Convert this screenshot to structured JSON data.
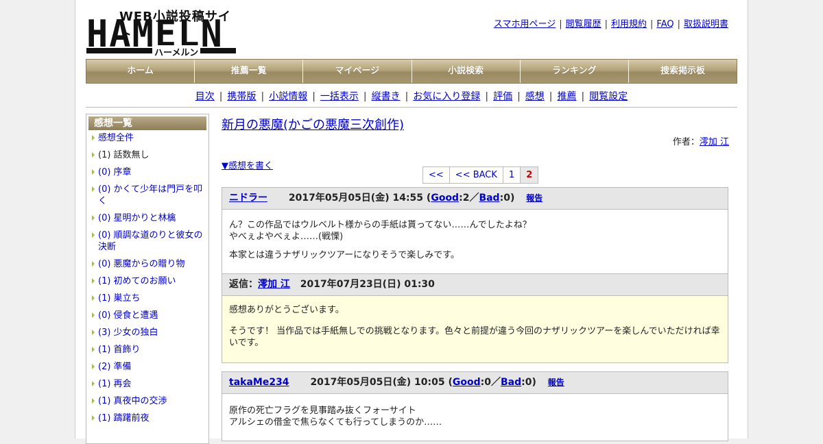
{
  "logo": {
    "web": "WEB小説投稿サイト",
    "big": "HAMELN",
    "kana": "ハーメルン"
  },
  "toplinks": [
    "スマホ用ページ",
    "閲覧履歴",
    "利用規約",
    "FAQ",
    "取扱説明書"
  ],
  "nav": [
    "ホーム",
    "推薦一覧",
    "マイページ",
    "小説検索",
    "ランキング",
    "捜索掲示板"
  ],
  "subnav": [
    "目次",
    "携帯版",
    "小説情報",
    "一括表示",
    "縦書き",
    "お気に入り登録",
    "評価",
    "感想",
    "推薦",
    "閲覧設定"
  ],
  "sidebar": {
    "title": "感想一覧",
    "items": [
      {
        "label": "感想全件",
        "current": false
      },
      {
        "label": "(1) 話数無し",
        "current": true
      },
      {
        "label": "(0) 序章",
        "current": false
      },
      {
        "label": "(0) かくて少年は門戸を叩く",
        "current": false
      },
      {
        "label": "(0) 星明かりと林檎",
        "current": false
      },
      {
        "label": "(0) 順調な道のりと彼女の決断",
        "current": false
      },
      {
        "label": "(0) 悪魔からの贈り物",
        "current": false
      },
      {
        "label": "(1) 初めてのお願い",
        "current": false
      },
      {
        "label": "(1) 巣立ち",
        "current": false
      },
      {
        "label": "(0) 侵食と遭遇",
        "current": false
      },
      {
        "label": "(3) 少女の独白",
        "current": false
      },
      {
        "label": "(1) 首飾り",
        "current": false
      },
      {
        "label": "(2) 準備",
        "current": false
      },
      {
        "label": "(1) 再会",
        "current": false
      },
      {
        "label": "(1) 真夜中の交渉",
        "current": false
      },
      {
        "label": "(1) 躊躇前夜",
        "current": false
      }
    ]
  },
  "main": {
    "title": "新月の悪魔(かごの悪魔三次創作)",
    "author_label": "作者：",
    "author": "澪加 江",
    "write": "▼感想を書く",
    "pager": [
      "<<",
      "<< BACK",
      "1",
      "2"
    ],
    "pager_current": "2"
  },
  "comments": [
    {
      "user": "ニドラー",
      "date": "2017年05月05日(金) 14:55",
      "good_label": "Good",
      "good": "2",
      "bad_label": "Bad",
      "bad": "0",
      "report": "報告",
      "body": [
        "ん？この作品ではウルベルト様からの手紙は貰ってない……んでしたよね？",
        "やべぇよやべぇよ……(戦慄)",
        "本家とは違うナザリックツアーになりそうで楽しみです。"
      ],
      "reply_label": "返信：",
      "reply_user": "澪加 江",
      "reply_date": "2017年07月23日(日) 01:30",
      "reply_body": [
        "感想ありがとうございます。",
        "そうです！ 当作品では手紙無しでの挑戦となります。色々と前提が違う今回のナザリックツアーを楽しんでいただければ幸いです。"
      ]
    },
    {
      "user": "takaMe234",
      "date": "2017年05月05日(金) 10:05",
      "good_label": "Good",
      "good": "0",
      "bad_label": "Bad",
      "bad": "0",
      "report": "報告",
      "body": [
        "原作の死亡フラグを見事踏み抜くフォーサイト",
        "アルシェの借金で焦らなくても行ってしまうのか……"
      ]
    }
  ]
}
